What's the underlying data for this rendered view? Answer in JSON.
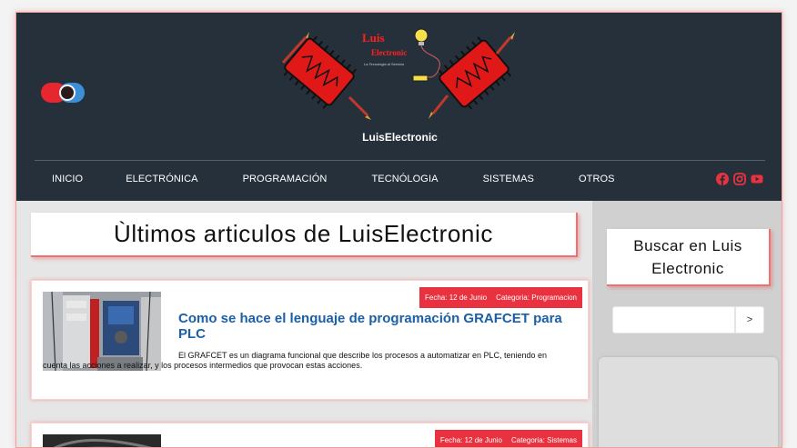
{
  "header": {
    "logo": {
      "line1": "Luis",
      "line2": "Electronic",
      "tagline": "La Tecnologia al Servicio"
    },
    "site_title": "LuisElectronic"
  },
  "nav": {
    "items": [
      "INICIO",
      "ELECTRÓNICA",
      "PROGRAMACIÓN",
      "TECNÓLOGIA",
      "SISTEMAS",
      "OTROS"
    ]
  },
  "social": {
    "icons": [
      "facebook-icon",
      "instagram-icon",
      "youtube-icon"
    ],
    "color": "#e8323f"
  },
  "main": {
    "heading": "Ùltimos articulos de LuisElectronic",
    "articles": [
      {
        "date": "Fecha: 12 de Junio",
        "category": "Categoria: Programacion",
        "title": "Como se hace el lenguaje de programación GRAFCET para PLC",
        "excerpt": "El GRAFCET es un diagrama funcional que describe los procesos a automatizar en PLC, teniendo en cuenta las acciones a realizar, y los procesos intermedios que provocan estas acciones."
      },
      {
        "date": "Fecha: 12 de Junio",
        "category": "Categoria: Sistemas"
      }
    ]
  },
  "sidebar": {
    "search_title": "Buscar en Luis Electronic",
    "search_value": "",
    "search_button": ">"
  },
  "colors": {
    "header_bg": "#26303b",
    "accent_red": "#e8323f",
    "title_blue": "#1a5fa8"
  }
}
